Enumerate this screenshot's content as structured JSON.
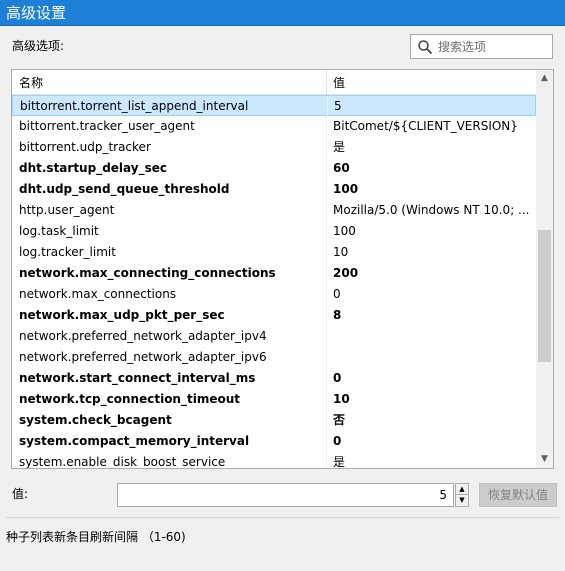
{
  "window": {
    "title": "高级设置"
  },
  "options_label": "高级选项:",
  "search": {
    "placeholder": "搜索选项"
  },
  "table": {
    "columns": [
      "名称",
      "值"
    ],
    "rows": [
      {
        "key": "bittorrent.torrent_list_append_interval",
        "value": "5",
        "bold": false,
        "selected": true
      },
      {
        "key": "bittorrent.tracker_user_agent",
        "value": "BitComet/${CLIENT_VERSION}",
        "bold": false,
        "selected": false
      },
      {
        "key": "bittorrent.udp_tracker",
        "value": "是",
        "bold": false,
        "selected": false
      },
      {
        "key": "dht.startup_delay_sec",
        "value": "60",
        "bold": true,
        "selected": false
      },
      {
        "key": "dht.udp_send_queue_threshold",
        "value": "100",
        "bold": true,
        "selected": false
      },
      {
        "key": "http.user_agent",
        "value": "Mozilla/5.0 (Windows NT 10.0; ...",
        "bold": false,
        "selected": false
      },
      {
        "key": "log.task_limit",
        "value": "100",
        "bold": false,
        "selected": false
      },
      {
        "key": "log.tracker_limit",
        "value": "10",
        "bold": false,
        "selected": false
      },
      {
        "key": "network.max_connecting_connections",
        "value": "200",
        "bold": true,
        "selected": false
      },
      {
        "key": "network.max_connections",
        "value": "0",
        "bold": false,
        "selected": false
      },
      {
        "key": "network.max_udp_pkt_per_sec",
        "value": "8",
        "bold": true,
        "selected": false
      },
      {
        "key": "network.preferred_network_adapter_ipv4",
        "value": "",
        "bold": false,
        "selected": false
      },
      {
        "key": "network.preferred_network_adapter_ipv6",
        "value": "",
        "bold": false,
        "selected": false
      },
      {
        "key": "network.start_connect_interval_ms",
        "value": "0",
        "bold": true,
        "selected": false
      },
      {
        "key": "network.tcp_connection_timeout",
        "value": "10",
        "bold": true,
        "selected": false
      },
      {
        "key": "system.check_bcagent",
        "value": "否",
        "bold": true,
        "selected": false
      },
      {
        "key": "system.compact_memory_interval",
        "value": "0",
        "bold": true,
        "selected": false
      },
      {
        "key": "system.enable_disk_boost_service",
        "value": "是",
        "bold": false,
        "selected": false
      }
    ]
  },
  "value_field": {
    "label": "值:",
    "value": "5"
  },
  "restore_button": "恢复默认值",
  "description": "种子列表新条目刷新间隔 （1-60)",
  "colors": {
    "titlebar": "#1e7fd6",
    "selection": "#cce8ff"
  },
  "icons": {
    "search": "search-icon"
  }
}
